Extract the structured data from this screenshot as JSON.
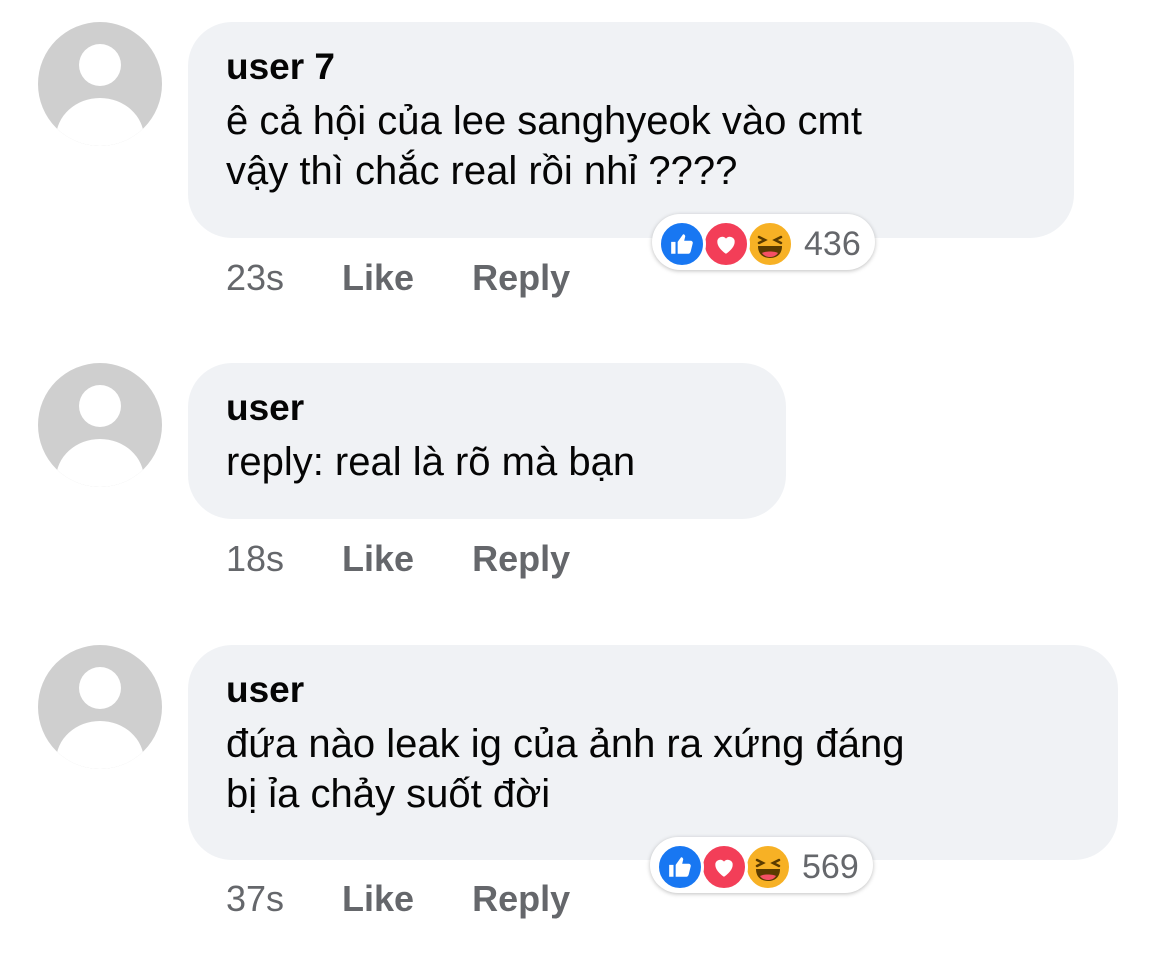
{
  "comments": [
    {
      "author": "user 7",
      "text_lines": [
        "ê cả hội của lee sanghyeok vào cmt",
        "vậy thì chắc real rồi nhỉ ????"
      ],
      "time": "23s",
      "like_label": "Like",
      "reply_label": "Reply",
      "reaction_count": "436",
      "reaction_icons": [
        "like-icon",
        "love-icon",
        "haha-icon"
      ]
    },
    {
      "author": "user",
      "text_lines": [
        "reply: real là rõ mà bạn"
      ],
      "time": "18s",
      "like_label": "Like",
      "reply_label": "Reply"
    },
    {
      "author": "user",
      "text_lines": [
        "đứa nào leak ig của ảnh ra xứng đáng",
        "bị ỉa chảy suốt đời"
      ],
      "time": "37s",
      "like_label": "Like",
      "reply_label": "Reply",
      "reaction_count": "569",
      "reaction_icons": [
        "like-icon",
        "love-icon",
        "haha-icon"
      ]
    }
  ],
  "colors": {
    "bubble_bg": "#f0f2f5",
    "meta_text": "#65676b",
    "like_blue": "#1877f2",
    "love_red": "#f33e58",
    "haha_yellow": "#f7b125"
  }
}
